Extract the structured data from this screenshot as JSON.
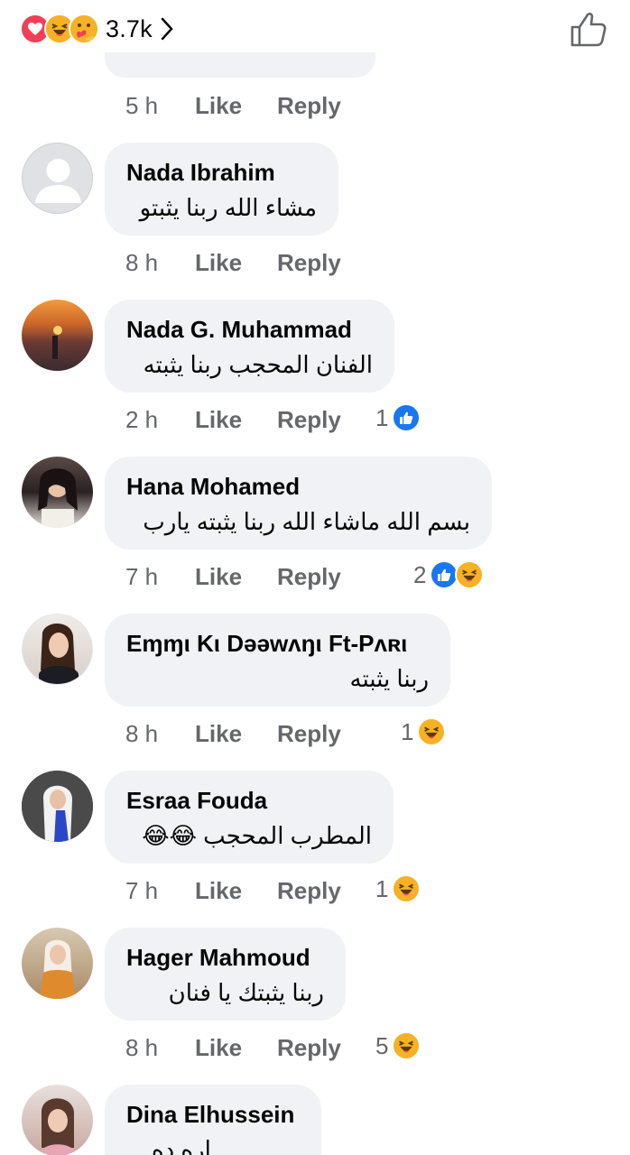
{
  "header": {
    "reaction_icons": [
      "love-icon",
      "haha-icon",
      "care-icon"
    ],
    "reaction_count": "3.7k",
    "like_icon": "thumbs-up-outline-icon"
  },
  "colors": {
    "bubble_bg": "#f0f2f5",
    "meta_text": "#65676b",
    "like_blue": "#1877f2",
    "haha_yellow": "#f7b125",
    "love_red": "#f33e58"
  },
  "labels": {
    "like": "Like",
    "reply": "Reply"
  },
  "previous_comment": {
    "time": "5 h"
  },
  "comments": [
    {
      "author": "Nada Ibrahim",
      "text": "مشاء الله ربنا يثبتو",
      "time": "8 h",
      "reaction_count": "",
      "reactions": []
    },
    {
      "author": "Nada G. Muhammad",
      "text": "الفنان المحجب ربنا يثبته",
      "time": "2 h",
      "reaction_count": "1",
      "reactions": [
        "like-icon"
      ]
    },
    {
      "author": "Hana Mohamed",
      "text": "بسم الله ماشاء الله ربنا يثبته يارب",
      "time": "7 h",
      "reaction_count": "2",
      "reactions": [
        "like-icon",
        "haha-icon"
      ]
    },
    {
      "author": "Eɱɱι Kι Dəəwʌŋι Ft-Pʌʀι",
      "text": "ربنا يثبته",
      "time": "8 h",
      "reaction_count": "1",
      "reactions": [
        "haha-icon"
      ]
    },
    {
      "author": "Esraa Fouda",
      "text": "المطرب المحجب 😂😂",
      "time": "7 h",
      "reaction_count": "1",
      "reactions": [
        "haha-icon"
      ]
    },
    {
      "author": "Hager Mahmoud",
      "text": "ربنا يثبتك يا فنان",
      "time": "8 h",
      "reaction_count": "5",
      "reactions": [
        "haha-icon"
      ]
    },
    {
      "author": "Dina Elhussein",
      "text": "اره ده",
      "time": "",
      "reaction_count": "",
      "reactions": []
    }
  ]
}
